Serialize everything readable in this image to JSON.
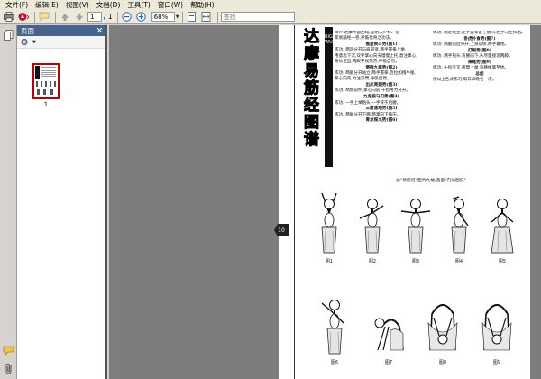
{
  "menu": [
    "文件(F)",
    "编辑(E)",
    "视图(V)",
    "文档(D)",
    "工具(T)",
    "窗口(W)",
    "帮助(H)"
  ],
  "toolbar": {
    "page_current": "1",
    "page_total": "/ 1",
    "zoom": "68%",
    "search_placeholder": "查找"
  },
  "panel": {
    "title": "页面",
    "thumbnail_number": "1"
  },
  "document": {
    "title_chars": [
      "达",
      "摩",
      "易",
      "筋",
      "经",
      "图",
      "谱"
    ],
    "side_label": "BIG WU",
    "page_badge": "10",
    "column_a": [
      {
        "type": "p",
        "text": "简介:达摩传自西域,是明末少林、道"
      },
      {
        "type": "p",
        "text": "家易筋经一卷,养筋壮骨之功法。"
      },
      {
        "type": "h",
        "text": "推星换斗势(图1)"
      },
      {
        "type": "p",
        "text": "练功: 两足分开与肩同宽,两手握拳上举,"
      },
      {
        "type": "p",
        "text": "用意念下沉,双手掌心向天慢慢上托,意注掌心,"
      },
      {
        "type": "p",
        "text": "身体正直,两眼平视前方,呼吸自然。"
      },
      {
        "type": "h",
        "text": "倒拽九尾势(图2)"
      },
      {
        "type": "p",
        "text": "练功: 两腿分开站立,两手握拳,后拉如拽牛尾,"
      },
      {
        "type": "p",
        "text": "拳心向内,力注双臂,呼吸自然。"
      },
      {
        "type": "h",
        "text": "出爪亮翅势(图3)"
      },
      {
        "type": "p",
        "text": "练功: 两臂前伸,掌心向前,十指用力分开。"
      },
      {
        "type": "h",
        "text": "九鬼拔马刀势(图4)"
      },
      {
        "type": "p",
        "text": "练功: 一手上举抱头,一手背于后腰。"
      },
      {
        "type": "h",
        "text": "三盘落地势(图5)"
      },
      {
        "type": "p",
        "text": "练功: 两腿分开下蹲,两掌向下按压。"
      },
      {
        "type": "h",
        "text": "青龙探爪势(图6)"
      }
    ],
    "column_b": [
      {
        "type": "p",
        "text": "练功: 两足站立,左手握拳置于腰间,右手向左探出。"
      },
      {
        "type": "h",
        "text": "卧虎扑食势(图7)"
      },
      {
        "type": "p",
        "text": "练功: 两腿前后分开,上身前俯,两手着地。"
      },
      {
        "type": "h",
        "text": "打躬势(图8)"
      },
      {
        "type": "p",
        "text": "练功: 两手抱头,弯腰向下,头尽量接近两膝。"
      },
      {
        "type": "h",
        "text": "掉尾势(图9)"
      },
      {
        "type": "p",
        "text": "练功: 十指交叉,两臂上举,弯腰推掌至地。"
      },
      {
        "type": "h",
        "text": "总结"
      },
      {
        "type": "p",
        "text": "按以上各式练习,每日早晚各一次。"
      }
    ],
    "caption": "此\"易筋经\"图共九幅,选自\"内功图说\"",
    "figure_labels": [
      "图1",
      "图2",
      "图3",
      "图4",
      "图5",
      "图6",
      "图7",
      "图8",
      "图9"
    ]
  },
  "colors": {
    "panel_header": "#46648c",
    "thumbnail_border": "#c00000",
    "doc_background": "#7d7d7d"
  }
}
